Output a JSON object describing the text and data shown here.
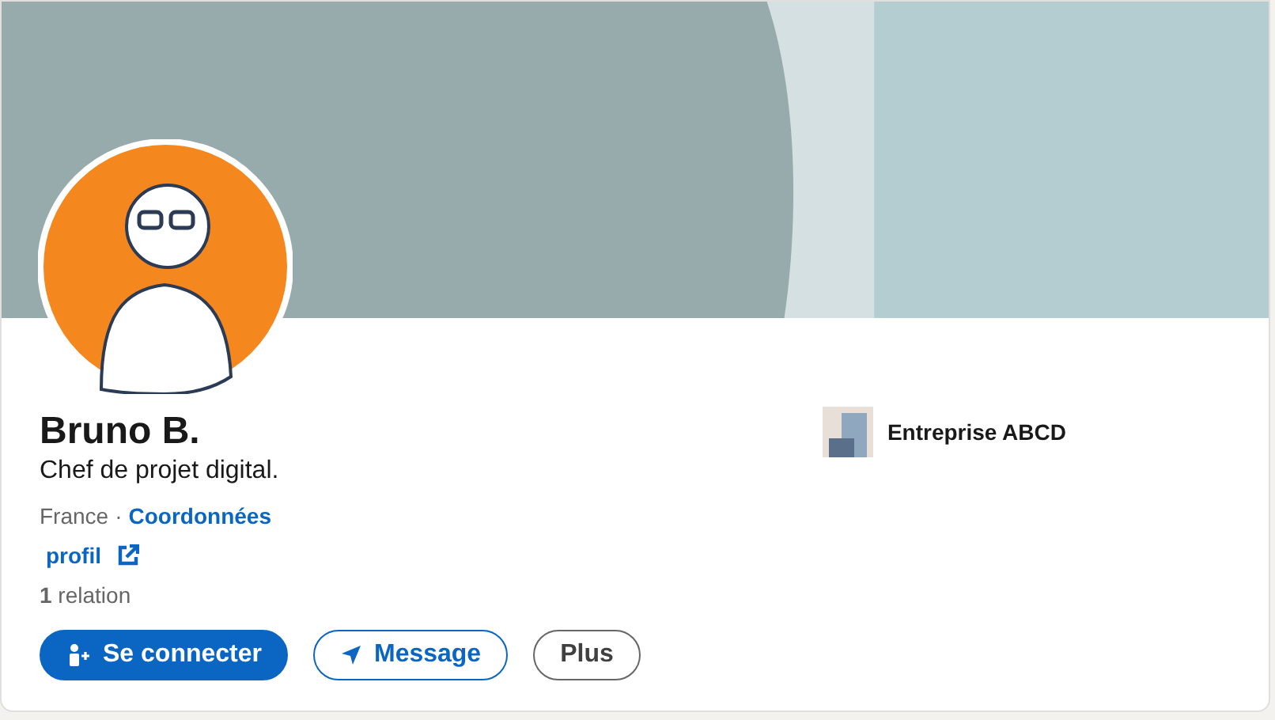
{
  "profile": {
    "name": "Bruno B.",
    "headline": "Chef de projet digital.",
    "location": "France",
    "contact_link": "Coordonnées",
    "separator": "·",
    "profile_link": "profil",
    "connections": "**1** relation"
  },
  "company": {
    "name": "Entreprise ABCD"
  },
  "actions": [
    {
      "kind": "primary",
      "label": "Se connecter"
    },
    {
      "kind": "outline-blue",
      "label": "Message"
    },
    {
      "kind": "outline-gray",
      "label": "Plus"
    }
  ]
}
